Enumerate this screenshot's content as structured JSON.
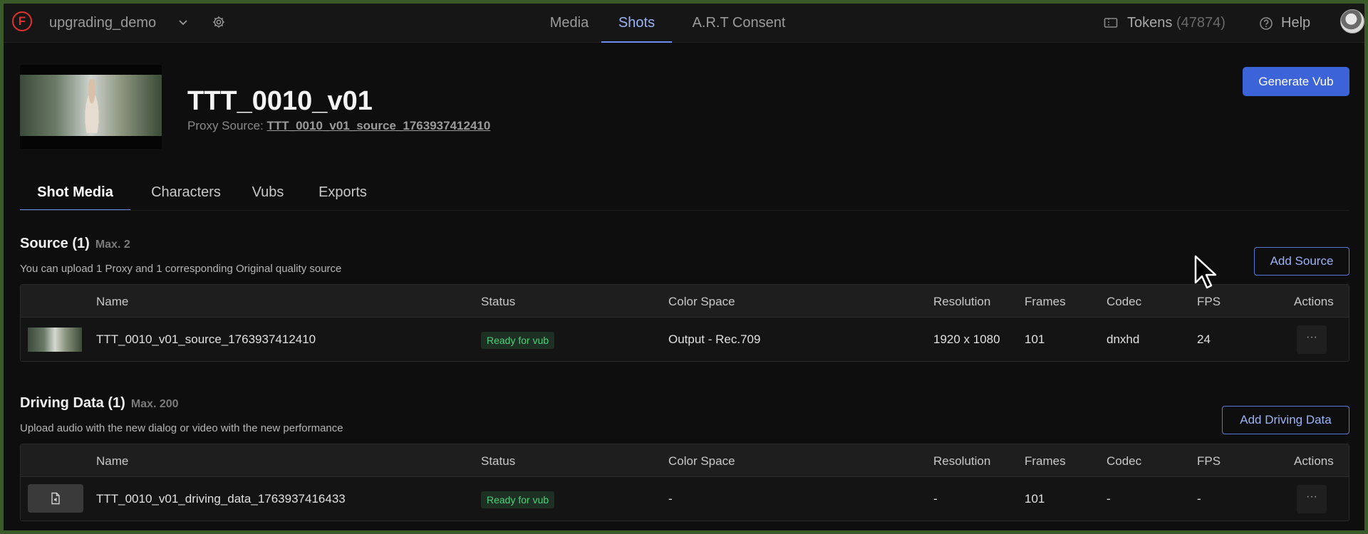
{
  "topbar": {
    "logo_letter": "F",
    "project_name": "upgrading_demo",
    "nav": [
      {
        "label": "Media"
      },
      {
        "label": "Shots"
      },
      {
        "label": "A.R.T Consent"
      }
    ],
    "active_nav": "Shots",
    "tokens_label": "Tokens",
    "tokens_count": "(47874)",
    "help_label": "Help"
  },
  "shot": {
    "title": "TTT_0010_v01",
    "proxy_label": "Proxy Source:",
    "proxy_value": "TTT_0010_v01_source_1763937412410",
    "generate_label": "Generate Vub"
  },
  "tabs": [
    {
      "label": "Shot Media"
    },
    {
      "label": "Characters"
    },
    {
      "label": "Vubs"
    },
    {
      "label": "Exports"
    }
  ],
  "active_tab": "Shot Media",
  "columns": [
    "Name",
    "Status",
    "Color Space",
    "Resolution",
    "Frames",
    "Codec",
    "FPS",
    "Actions"
  ],
  "source": {
    "title": "Source (1)",
    "max": "Max. 2",
    "description": "You can upload 1 Proxy and 1 corresponding Original quality source",
    "add_label": "Add Source",
    "rows": [
      {
        "name": "TTT_0010_v01_source_1763937412410",
        "status": "Ready for vub",
        "color_space": "Output - Rec.709",
        "resolution": "1920 x 1080",
        "frames": "101",
        "codec": "dnxhd",
        "fps": "24",
        "actions": "···"
      }
    ]
  },
  "driving": {
    "title": "Driving Data (1)",
    "max": "Max. 200",
    "description": "Upload audio with the new dialog or video with the new performance",
    "add_label": "Add Driving Data",
    "rows": [
      {
        "name": "TTT_0010_v01_driving_data_1763937416433",
        "status": "Ready for vub",
        "color_space": "-",
        "resolution": "-",
        "frames": "101",
        "codec": "-",
        "fps": "-",
        "actions": "···"
      }
    ]
  },
  "colors": {
    "accent": "#3d63d9",
    "accent_text": "#9cb3f5",
    "status_bg": "#1d3023",
    "status_text": "#4fd07a",
    "logo": "#e0322d"
  },
  "icons": [
    "logo-icon",
    "chevron-down-icon",
    "gear-icon",
    "ticket-icon",
    "help-icon",
    "avatar",
    "file-audio-icon",
    "more-icon",
    "mouse-cursor-icon"
  ]
}
